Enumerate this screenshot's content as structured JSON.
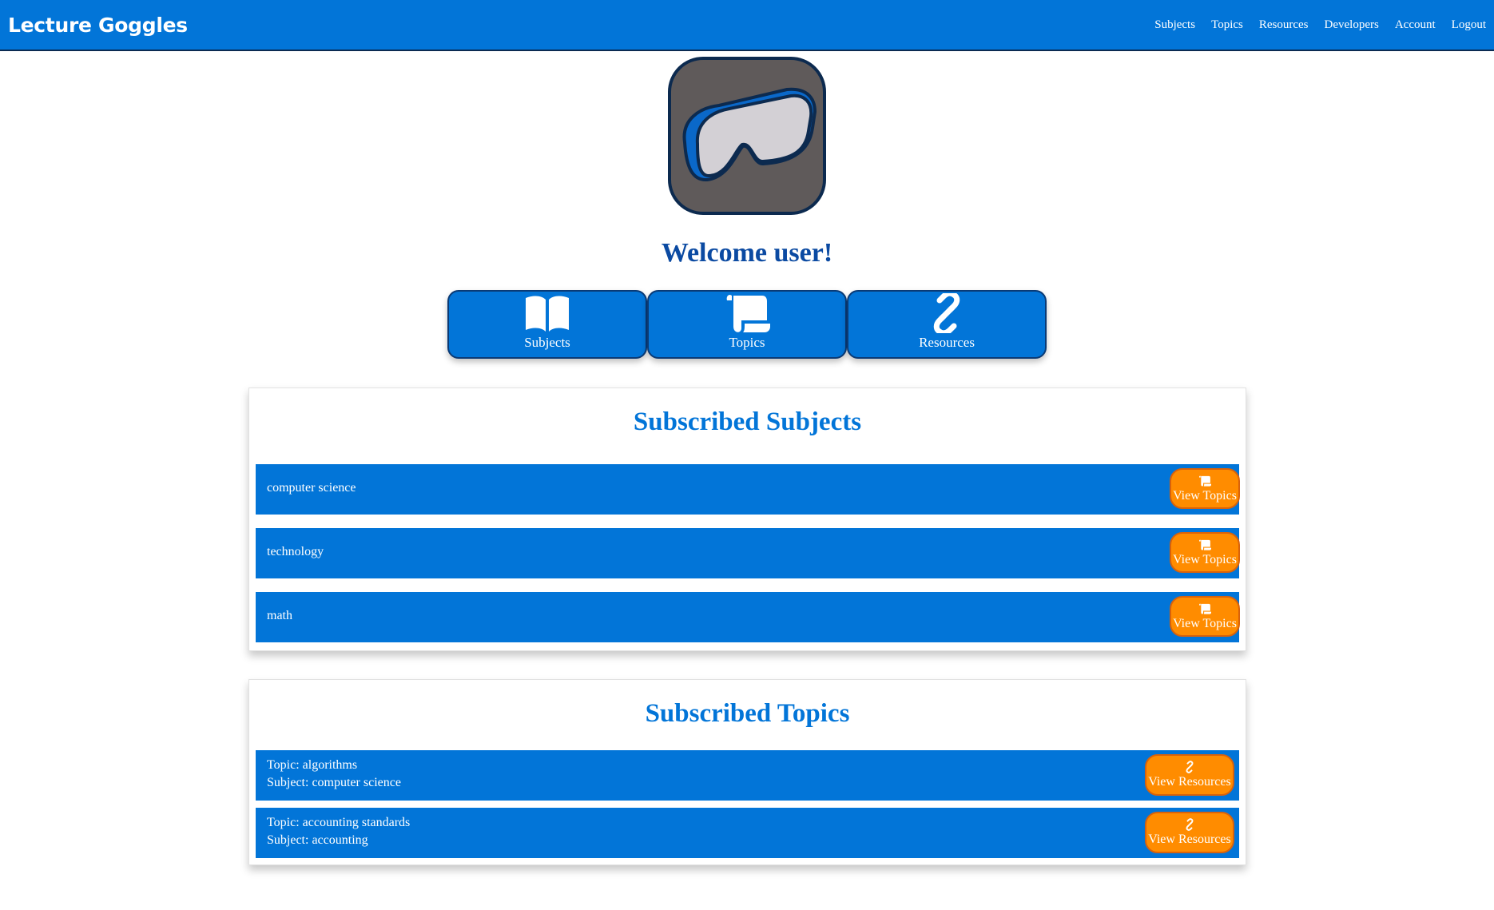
{
  "app": {
    "brand": "Lecture Goggles"
  },
  "nav": {
    "links": [
      "Subjects",
      "Topics",
      "Resources",
      "Developers",
      "Account",
      "Logout"
    ]
  },
  "welcome": "Welcome user!",
  "quick_buttons": [
    {
      "label": "Subjects",
      "icon": "book-icon"
    },
    {
      "label": "Topics",
      "icon": "scroll-icon"
    },
    {
      "label": "Resources",
      "icon": "link-icon"
    }
  ],
  "subscribed_subjects": {
    "title": "Subscribed Subjects",
    "button_label": "View Topics",
    "items": [
      "computer science",
      "technology",
      "math"
    ]
  },
  "subscribed_topics": {
    "title": "Subscribed Topics",
    "button_label": "View Resources",
    "items": [
      {
        "topic": "Topic: algorithms",
        "subject": "Subject: computer science"
      },
      {
        "topic": "Topic: accounting standards",
        "subject": "Subject: accounting"
      }
    ]
  },
  "colors": {
    "primary": "#0275d8",
    "accent": "#ff8c00",
    "heading": "#0b4aa2"
  }
}
